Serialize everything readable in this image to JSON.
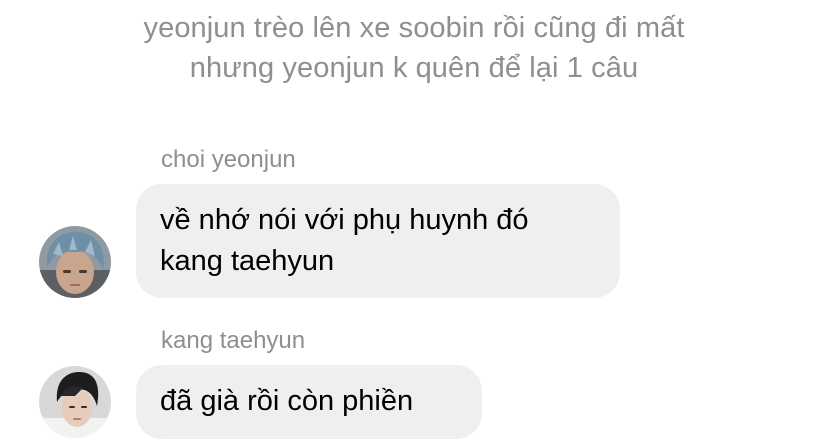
{
  "system_notice": {
    "line1": "yeonjun trèo lên xe soobin rồi cũng đi mất",
    "line2": "nhưng yeonjun k quên để lại 1 câu"
  },
  "messages": [
    {
      "sender": "choi yeonjun",
      "avatar_icon": "avatar-photo-blue-hair",
      "lines": [
        "về nhớ nói với phụ huynh đó",
        "kang taehyun"
      ]
    },
    {
      "sender": "kang taehyun",
      "avatar_icon": "avatar-photo-dark-hair",
      "lines": [
        "đã già rồi còn phiền"
      ]
    }
  ],
  "colors": {
    "bubble_bg": "#efeff0",
    "secondary_text": "#8e8e93",
    "message_text": "#000000"
  }
}
